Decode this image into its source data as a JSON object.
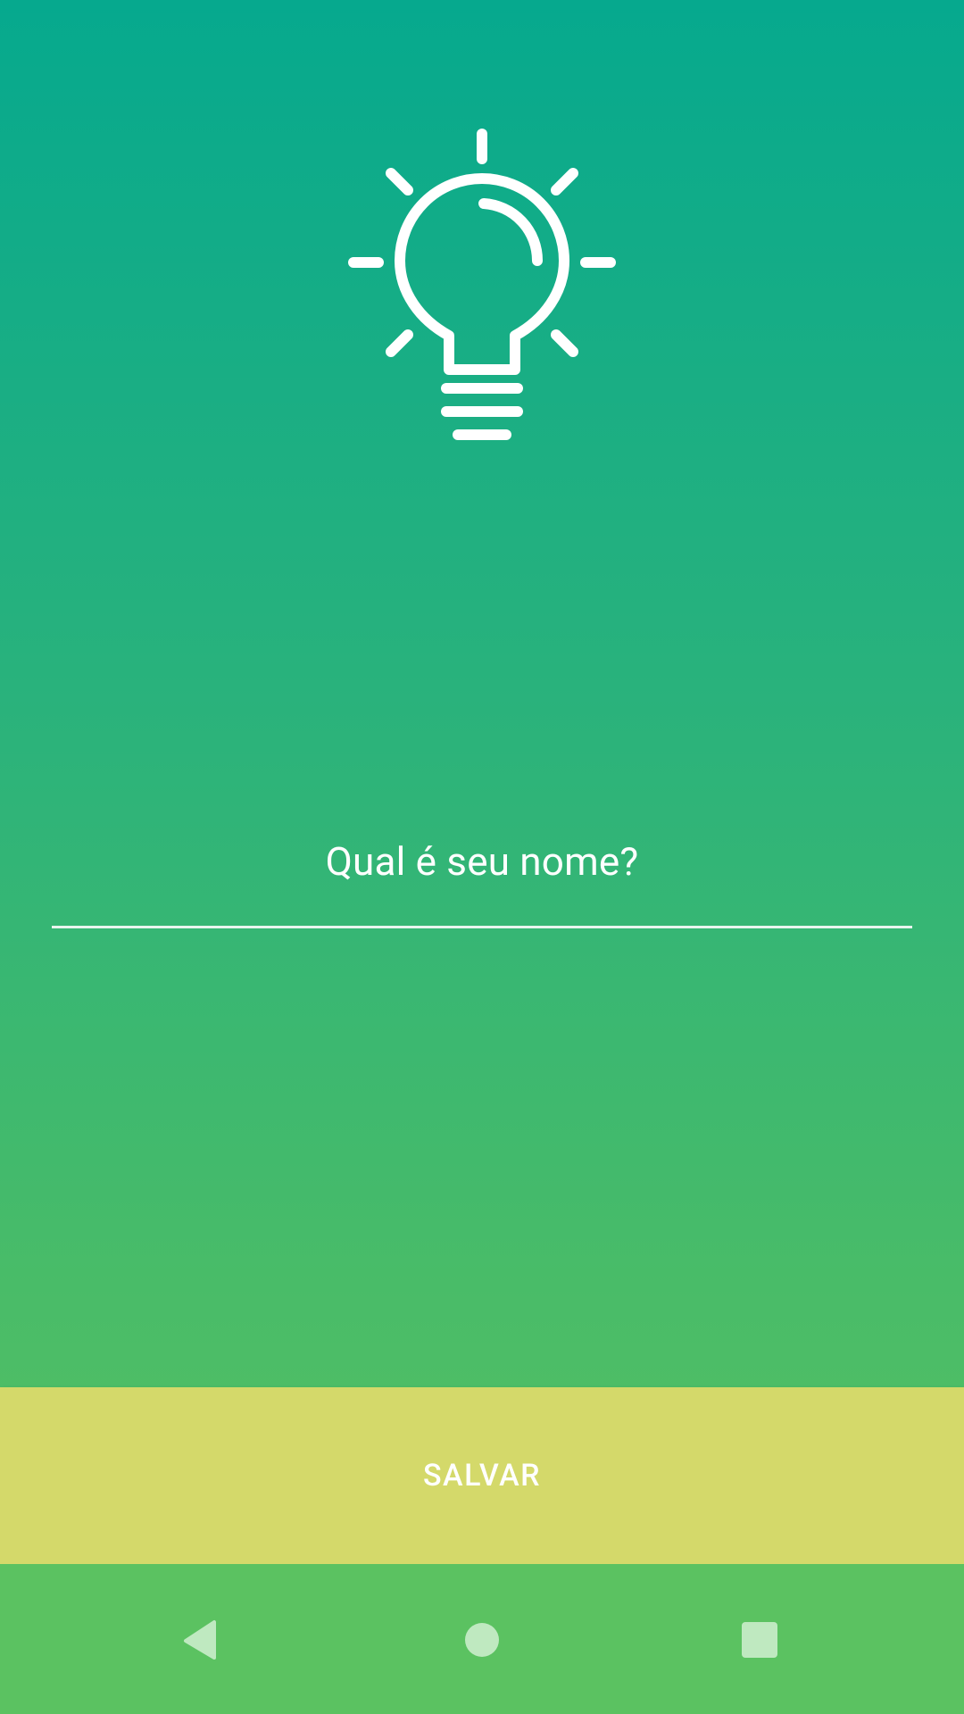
{
  "screen": {
    "name_prompt": "Qual é seu nome?",
    "name_value": "",
    "save_label": "SALVAR"
  },
  "icons": {
    "logo": "lightbulb-icon",
    "back": "back-triangle-icon",
    "home": "home-circle-icon",
    "recent": "recent-apps-square-icon"
  },
  "colors": {
    "gradient_top": "#06a98e",
    "gradient_bottom": "#5bc261",
    "button": "#d4d96a",
    "text": "#ffffff"
  }
}
